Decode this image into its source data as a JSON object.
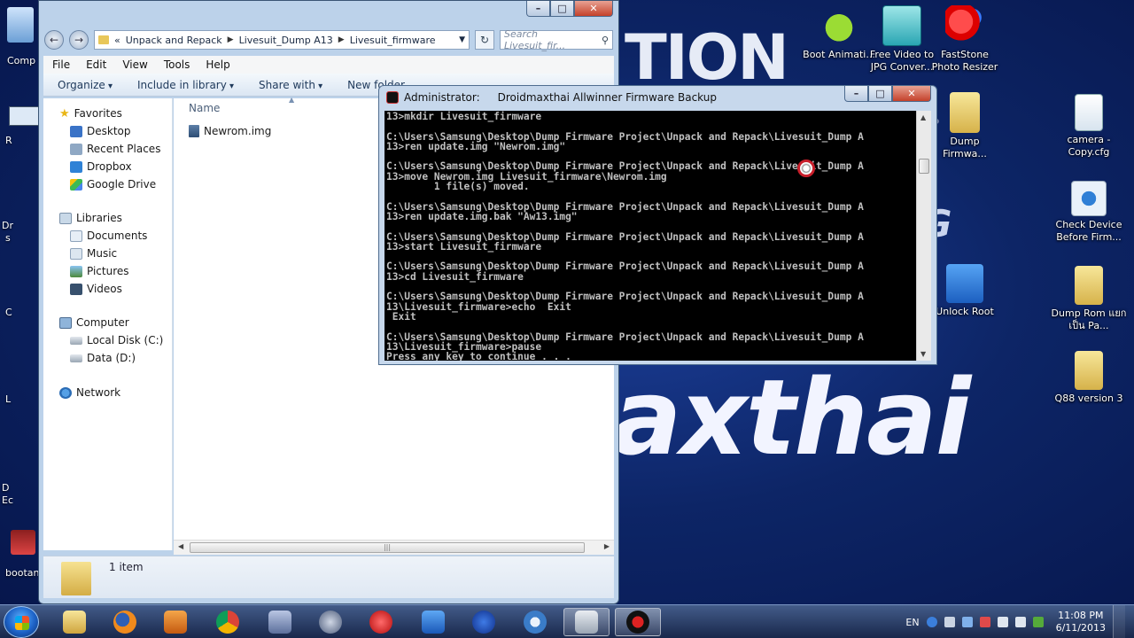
{
  "explorer": {
    "address": {
      "parts": [
        "Unpack and Repack",
        "Livesuit_Dump A13",
        "Livesuit_firmware"
      ],
      "prefix": "«"
    },
    "search_placeholder": "Search Livesuit_fir...",
    "menu": [
      "File",
      "Edit",
      "View",
      "Tools",
      "Help"
    ],
    "commands": {
      "organize": "Organize",
      "include": "Include in library",
      "share": "Share with",
      "new_folder": "New folder"
    },
    "nav": {
      "favorites": "Favorites",
      "favorites_items": [
        "Desktop",
        "Recent Places",
        "Dropbox",
        "Google Drive"
      ],
      "libraries": "Libraries",
      "libraries_items": [
        "Documents",
        "Music",
        "Pictures",
        "Videos"
      ],
      "computer": "Computer",
      "computer_items": [
        "Local Disk (C:)",
        "Data (D:)"
      ],
      "network": "Network"
    },
    "column_name": "Name",
    "files": [
      "Newrom.img"
    ],
    "item_count": "1 item"
  },
  "cmd": {
    "title_user": "Administrator:",
    "title": "Droidmaxthai Allwinner Firmware Backup",
    "output": "13>mkdir Livesuit_firmware\n\nC:\\Users\\Samsung\\Desktop\\Dump Firmware Project\\Unpack and Repack\\Livesuit_Dump A\n13>ren update.img \"Newrom.img\"\n\nC:\\Users\\Samsung\\Desktop\\Dump Firmware Project\\Unpack and Repack\\Livesuit_Dump A\n13>move Newrom.img Livesuit_firmware\\Newrom.img\n        1 file(s) moved.\n\nC:\\Users\\Samsung\\Desktop\\Dump Firmware Project\\Unpack and Repack\\Livesuit_Dump A\n13>ren update.img.bak \"Aw13.img\"\n\nC:\\Users\\Samsung\\Desktop\\Dump Firmware Project\\Unpack and Repack\\Livesuit_Dump A\n13>start Livesuit_firmware\n\nC:\\Users\\Samsung\\Desktop\\Dump Firmware Project\\Unpack and Repack\\Livesuit_Dump A\n13>cd Livesuit_firmware\n\nC:\\Users\\Samsung\\Desktop\\Dump Firmware Project\\Unpack and Repack\\Livesuit_Dump A\n13\\Livesuit_firmware>echo  Exit\n Exit\n\nC:\\Users\\Samsung\\Desktop\\Dump Firmware Project\\Unpack and Repack\\Livesuit_Dump A\n13\\Livesuit_firmware>pause\nPress any key to continue . . ."
  },
  "desktop_icons": [
    {
      "label": "Boot Animati...",
      "icon": "android-icon"
    },
    {
      "label": "Free Video to JPG Conver...",
      "icon": "video-jpg-icon"
    },
    {
      "label": "FastStone Photo Resizer",
      "icon": "faststone-icon"
    },
    {
      "label": "Dump Firmwa...",
      "icon": "folder-icon"
    },
    {
      "label": "camera - Copy.cfg",
      "icon": "cfg-file-icon"
    },
    {
      "label": "Check Device Before Firm...",
      "icon": "settings-file-icon"
    },
    {
      "label": "Unlock Root",
      "icon": "unlock-root-icon"
    },
    {
      "label": "Dump Rom แยกเป็น Pa...",
      "icon": "folder-icon"
    },
    {
      "label": "Q88 version 3",
      "icon": "folder-icon"
    }
  ],
  "edge_labels": [
    "Comp",
    "R",
    "Dr",
    "s",
    "C",
    "L",
    "D",
    "Ec",
    "bootan"
  ],
  "background_text": {
    "top": "TION",
    "middle": "G",
    "big": "axthai"
  },
  "taskbar": {
    "apps": [
      "explorer-icon",
      "firefox-icon",
      "media-player-icon",
      "chrome-icon",
      "dmt-icon",
      "dump-tool-icon",
      "dmt-tool-icon",
      "unlock-tool-icon",
      "dmt-script-icon",
      "camera-icon",
      "folder-window-icon",
      "droidmaxthai-icon"
    ],
    "language": "EN",
    "time": "11:08 PM",
    "date": "6/11/2013"
  },
  "colors": {
    "console_bg": "#000000",
    "console_text": "#c0c0c0",
    "accent": "#1d62c7",
    "close_red": "#c4412a"
  }
}
